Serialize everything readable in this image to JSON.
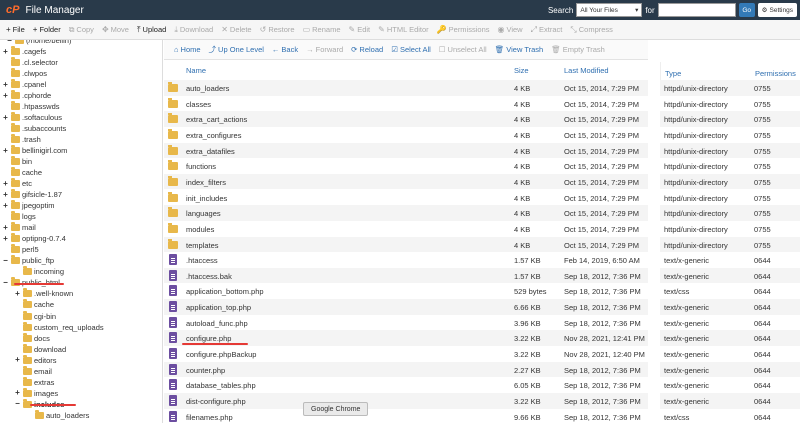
{
  "header": {
    "logo_text": "cP",
    "title": "File Manager",
    "search_label": "Search",
    "search_scope": "All Your Files",
    "for_label": "for",
    "go_label": "Go",
    "settings_label": "Settings"
  },
  "toolbar": [
    {
      "icon": "+",
      "label": "File",
      "active": true
    },
    {
      "icon": "+",
      "label": "Folder",
      "active": true
    },
    {
      "icon": "⧉",
      "label": "Copy",
      "active": false
    },
    {
      "icon": "✥",
      "label": "Move",
      "active": false
    },
    {
      "icon": "⤒",
      "label": "Upload",
      "active": true
    },
    {
      "icon": "⤓",
      "label": "Download",
      "active": false
    },
    {
      "icon": "✕",
      "label": "Delete",
      "active": false
    },
    {
      "icon": "↺",
      "label": "Restore",
      "active": false
    },
    {
      "icon": "▭",
      "label": "Rename",
      "active": false
    },
    {
      "icon": "✎",
      "label": "Edit",
      "active": false
    },
    {
      "icon": "✎",
      "label": "HTML Editor",
      "active": false
    },
    {
      "icon": "🔑",
      "label": "Permissions",
      "active": false
    },
    {
      "icon": "◉",
      "label": "View",
      "active": false
    },
    {
      "icon": "⤢",
      "label": "Extract",
      "active": false
    },
    {
      "icon": "⤡",
      "label": "Compress",
      "active": false
    }
  ],
  "navbar": [
    {
      "icon": "⌂",
      "label": "Home",
      "disabled": false
    },
    {
      "icon": "⤴",
      "label": "Up One Level",
      "disabled": false
    },
    {
      "icon": "←",
      "label": "Back",
      "disabled": false
    },
    {
      "icon": "→",
      "label": "Forward",
      "disabled": true
    },
    {
      "icon": "⟳",
      "label": "Reload",
      "disabled": false
    },
    {
      "icon": "☑",
      "label": "Select All",
      "disabled": false
    },
    {
      "icon": "☐",
      "label": "Unselect All",
      "disabled": true
    },
    {
      "icon": "🗑",
      "label": "View Trash",
      "disabled": false
    },
    {
      "icon": "🗑",
      "label": "Empty Trash",
      "disabled": true
    }
  ],
  "columns": {
    "name": "Name",
    "size": "Size",
    "modified": "Last Modified",
    "type": "Type",
    "perms": "Permissions"
  },
  "tree": [
    {
      "label": "(/home/bellin)",
      "exp": "−",
      "indent": 1
    },
    {
      "label": ".cagefs",
      "exp": "+",
      "indent": 2
    },
    {
      "label": ".cl.selector",
      "exp": "",
      "indent": 2
    },
    {
      "label": ".clwpos",
      "exp": "",
      "indent": 2
    },
    {
      "label": ".cpanel",
      "exp": "+",
      "indent": 2
    },
    {
      "label": ".cphorde",
      "exp": "+",
      "indent": 2
    },
    {
      "label": ".htpasswds",
      "exp": "",
      "indent": 2
    },
    {
      "label": ".softaculous",
      "exp": "+",
      "indent": 2
    },
    {
      "label": ".subaccounts",
      "exp": "",
      "indent": 2
    },
    {
      "label": ".trash",
      "exp": "",
      "indent": 2
    },
    {
      "label": "bellinigirl.com",
      "exp": "+",
      "indent": 2
    },
    {
      "label": "bin",
      "exp": "",
      "indent": 2
    },
    {
      "label": "cache",
      "exp": "",
      "indent": 2
    },
    {
      "label": "etc",
      "exp": "+",
      "indent": 2
    },
    {
      "label": "gifsicle-1.87",
      "exp": "+",
      "indent": 2
    },
    {
      "label": "jpegoptim",
      "exp": "+",
      "indent": 2
    },
    {
      "label": "logs",
      "exp": "",
      "indent": 2
    },
    {
      "label": "mail",
      "exp": "+",
      "indent": 2
    },
    {
      "label": "optipng-0.7.4",
      "exp": "+",
      "indent": 2
    },
    {
      "label": "perl5",
      "exp": "",
      "indent": 2
    },
    {
      "label": "public_ftp",
      "exp": "−",
      "indent": 2
    },
    {
      "label": "incoming",
      "exp": "",
      "indent": 3
    },
    {
      "label": "public_html",
      "exp": "−",
      "indent": 2
    },
    {
      "label": ".well-known",
      "exp": "+",
      "indent": 3
    },
    {
      "label": "cache",
      "exp": "",
      "indent": 3
    },
    {
      "label": "cgi-bin",
      "exp": "",
      "indent": 3
    },
    {
      "label": "custom_req_uploads",
      "exp": "",
      "indent": 3
    },
    {
      "label": "docs",
      "exp": "",
      "indent": 3
    },
    {
      "label": "download",
      "exp": "",
      "indent": 3
    },
    {
      "label": "editors",
      "exp": "+",
      "indent": 3
    },
    {
      "label": "email",
      "exp": "",
      "indent": 3
    },
    {
      "label": "extras",
      "exp": "",
      "indent": 3
    },
    {
      "label": "images",
      "exp": "+",
      "indent": 3
    },
    {
      "label": "includes",
      "exp": "−",
      "indent": 3,
      "selected": true
    },
    {
      "label": "auto_loaders",
      "exp": "",
      "indent": 4
    }
  ],
  "files": [
    {
      "name": "auto_loaders",
      "kind": "folder",
      "size": "4 KB",
      "modified": "Oct 15, 2014, 7:29 PM",
      "type": "httpd/unix-directory",
      "perms": "0755"
    },
    {
      "name": "classes",
      "kind": "folder",
      "size": "4 KB",
      "modified": "Oct 15, 2014, 7:29 PM",
      "type": "httpd/unix-directory",
      "perms": "0755"
    },
    {
      "name": "extra_cart_actions",
      "kind": "folder",
      "size": "4 KB",
      "modified": "Oct 15, 2014, 7:29 PM",
      "type": "httpd/unix-directory",
      "perms": "0755"
    },
    {
      "name": "extra_configures",
      "kind": "folder",
      "size": "4 KB",
      "modified": "Oct 15, 2014, 7:29 PM",
      "type": "httpd/unix-directory",
      "perms": "0755"
    },
    {
      "name": "extra_datafiles",
      "kind": "folder",
      "size": "4 KB",
      "modified": "Oct 15, 2014, 7:29 PM",
      "type": "httpd/unix-directory",
      "perms": "0755"
    },
    {
      "name": "functions",
      "kind": "folder",
      "size": "4 KB",
      "modified": "Oct 15, 2014, 7:29 PM",
      "type": "httpd/unix-directory",
      "perms": "0755"
    },
    {
      "name": "index_filters",
      "kind": "folder",
      "size": "4 KB",
      "modified": "Oct 15, 2014, 7:29 PM",
      "type": "httpd/unix-directory",
      "perms": "0755"
    },
    {
      "name": "init_includes",
      "kind": "folder",
      "size": "4 KB",
      "modified": "Oct 15, 2014, 7:29 PM",
      "type": "httpd/unix-directory",
      "perms": "0755"
    },
    {
      "name": "languages",
      "kind": "folder",
      "size": "4 KB",
      "modified": "Oct 15, 2014, 7:29 PM",
      "type": "httpd/unix-directory",
      "perms": "0755"
    },
    {
      "name": "modules",
      "kind": "folder",
      "size": "4 KB",
      "modified": "Oct 15, 2014, 7:29 PM",
      "type": "httpd/unix-directory",
      "perms": "0755"
    },
    {
      "name": "templates",
      "kind": "folder",
      "size": "4 KB",
      "modified": "Oct 15, 2014, 7:29 PM",
      "type": "httpd/unix-directory",
      "perms": "0755"
    },
    {
      "name": ".htaccess",
      "kind": "file",
      "size": "1.57 KB",
      "modified": "Feb 14, 2019, 6:50 AM",
      "type": "text/x-generic",
      "perms": "0644"
    },
    {
      "name": ".htaccess.bak",
      "kind": "file",
      "size": "1.57 KB",
      "modified": "Sep 18, 2012, 7:36 PM",
      "type": "text/x-generic",
      "perms": "0644"
    },
    {
      "name": "application_bottom.php",
      "kind": "file",
      "size": "529 bytes",
      "modified": "Sep 18, 2012, 7:36 PM",
      "type": "text/css",
      "perms": "0644"
    },
    {
      "name": "application_top.php",
      "kind": "file",
      "size": "6.66 KB",
      "modified": "Sep 18, 2012, 7:36 PM",
      "type": "text/x-generic",
      "perms": "0644"
    },
    {
      "name": "autoload_func.php",
      "kind": "file",
      "size": "3.96 KB",
      "modified": "Sep 18, 2012, 7:36 PM",
      "type": "text/x-generic",
      "perms": "0644"
    },
    {
      "name": "configure.php",
      "kind": "file",
      "size": "3.22 KB",
      "modified": "Nov 28, 2021, 12:41 PM",
      "type": "text/x-generic",
      "perms": "0644",
      "marked": true
    },
    {
      "name": "configure.phpBackup",
      "kind": "file",
      "size": "3.22 KB",
      "modified": "Nov 28, 2021, 12:40 PM",
      "type": "text/x-generic",
      "perms": "0644"
    },
    {
      "name": "counter.php",
      "kind": "file",
      "size": "2.27 KB",
      "modified": "Sep 18, 2012, 7:36 PM",
      "type": "text/x-generic",
      "perms": "0644"
    },
    {
      "name": "database_tables.php",
      "kind": "file",
      "size": "6.05 KB",
      "modified": "Sep 18, 2012, 7:36 PM",
      "type": "text/x-generic",
      "perms": "0644"
    },
    {
      "name": "dist-configure.php",
      "kind": "file",
      "size": "3.22 KB",
      "modified": "Sep 18, 2012, 7:36 PM",
      "type": "text/x-generic",
      "perms": "0644"
    },
    {
      "name": "filenames.php",
      "kind": "file",
      "size": "9.66 KB",
      "modified": "Sep 18, 2012, 7:36 PM",
      "type": "text/css",
      "perms": "0644"
    }
  ],
  "tooltip": "Google Chrome"
}
